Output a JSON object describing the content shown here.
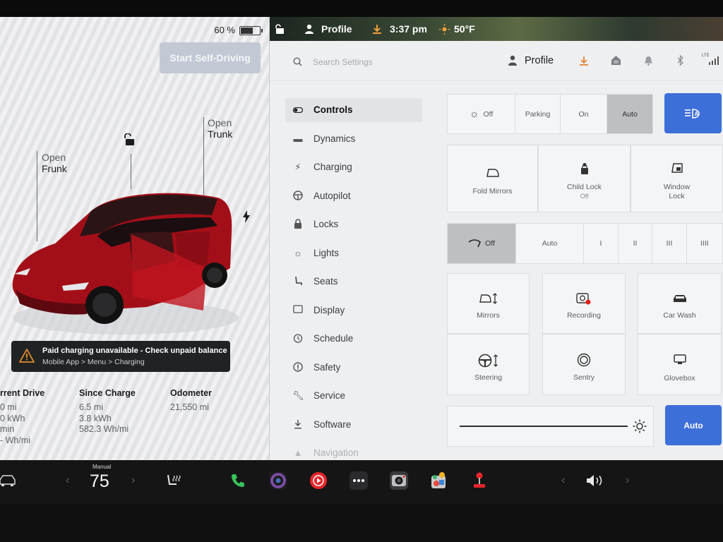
{
  "car_panel": {
    "battery_percent": "60 %",
    "battery_level": 0.6,
    "self_driving_button": "Start Self-Driving",
    "frunk": {
      "line1": "Open",
      "line2": "Frunk"
    },
    "trunk": {
      "line1": "Open",
      "line2": "Trunk"
    },
    "alert": {
      "title": "Paid charging unavailable - Check unpaid balance",
      "path": "Mobile App > Menu > Charging"
    },
    "trips": [
      {
        "header": "rrent Drive",
        "lines": [
          "0 mi",
          "0 kWh",
          "min",
          "- Wh/mi"
        ]
      },
      {
        "header": "Since Charge",
        "lines": [
          "6.5 mi",
          "3.8 kWh",
          "582.3 Wh/mi"
        ]
      },
      {
        "header": "Odometer",
        "lines": [
          "21,550 mi"
        ]
      }
    ]
  },
  "status_bar": {
    "profile": "Profile",
    "time": "3:37 pm",
    "temperature": "50°F"
  },
  "settings_header": {
    "search_placeholder": "Search Settings",
    "profile": "Profile",
    "lte": "LTE"
  },
  "nav": [
    {
      "label": "Controls",
      "icon": "toggle-icon"
    },
    {
      "label": "Dynamics",
      "icon": "car-icon"
    },
    {
      "label": "Charging",
      "icon": "bolt-icon"
    },
    {
      "label": "Autopilot",
      "icon": "steering-wheel-icon"
    },
    {
      "label": "Locks",
      "icon": "lock-icon"
    },
    {
      "label": "Lights",
      "icon": "bulb-icon"
    },
    {
      "label": "Seats",
      "icon": "seat-icon"
    },
    {
      "label": "Display",
      "icon": "display-icon"
    },
    {
      "label": "Schedule",
      "icon": "clock-icon"
    },
    {
      "label": "Safety",
      "icon": "safety-icon"
    },
    {
      "label": "Service",
      "icon": "wrench-icon"
    },
    {
      "label": "Software",
      "icon": "download-icon"
    },
    {
      "label": "Navigation",
      "icon": "navigation-icon"
    }
  ],
  "lights": {
    "options": [
      "Off",
      "Parking",
      "On",
      "Auto"
    ],
    "selected": "Auto"
  },
  "locks_tiles": [
    {
      "label": "Fold Mirrors",
      "sub": ""
    },
    {
      "label": "Child Lock",
      "sub": "Off"
    },
    {
      "label": "Window",
      "sub": "Lock"
    }
  ],
  "wipers": {
    "options": [
      "Off",
      "Auto",
      "I",
      "II",
      "III",
      "IIII"
    ],
    "selected": "Off"
  },
  "quick_tiles": [
    {
      "label": "Mirrors"
    },
    {
      "label": "Recording"
    },
    {
      "label": "Car Wash"
    },
    {
      "label": "Steering"
    },
    {
      "label": "Sentry"
    },
    {
      "label": "Glovebox"
    }
  ],
  "brightness": {
    "auto_label": "Auto",
    "level": 0.99
  },
  "dock": {
    "climate_mode": "Manual",
    "temperature": "75"
  },
  "colors": {
    "accent_blue": "#3d6fd9",
    "car_red": "#b0121d",
    "alert_orange": "#e08b2c"
  }
}
